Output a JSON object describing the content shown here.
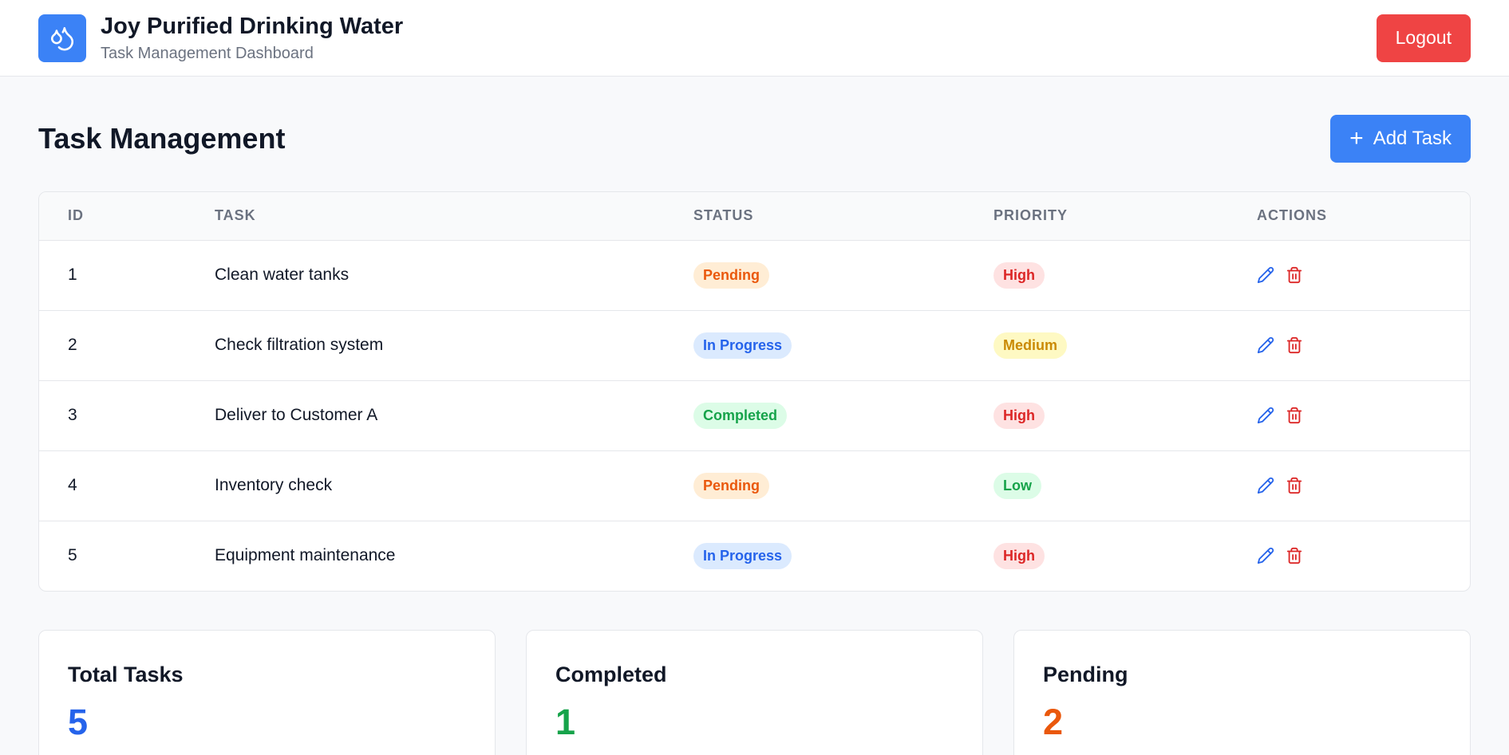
{
  "header": {
    "title": "Joy Purified Drinking Water",
    "subtitle": "Task Management Dashboard",
    "logout_label": "Logout",
    "logo_icon": "water-drops-icon",
    "logo_color": "#3b82f6",
    "logout_color": "#ef4444"
  },
  "main": {
    "title": "Task Management",
    "add_task_label": "Add Task"
  },
  "table": {
    "columns": [
      "ID",
      "TASK",
      "STATUS",
      "PRIORITY",
      "ACTIONS"
    ],
    "rows": [
      {
        "id": "1",
        "task": "Clean water tanks",
        "status": "Pending",
        "priority": "High"
      },
      {
        "id": "2",
        "task": "Check filtration system",
        "status": "In Progress",
        "priority": "Medium"
      },
      {
        "id": "3",
        "task": "Deliver to Customer A",
        "status": "Completed",
        "priority": "High"
      },
      {
        "id": "4",
        "task": "Inventory check",
        "status": "Pending",
        "priority": "Low"
      },
      {
        "id": "5",
        "task": "Equipment maintenance",
        "status": "In Progress",
        "priority": "High"
      }
    ],
    "action_icons": [
      "pencil-icon",
      "trash-icon"
    ]
  },
  "badge_colors": {
    "Pending": {
      "bg": "#ffedd5",
      "fg": "#ea580c"
    },
    "In Progress": {
      "bg": "#dbeafe",
      "fg": "#2563eb"
    },
    "Completed": {
      "bg": "#dcfce7",
      "fg": "#16a34a"
    },
    "High": {
      "bg": "#fee2e2",
      "fg": "#dc2626"
    },
    "Medium": {
      "bg": "#fef9c3",
      "fg": "#ca8a04"
    },
    "Low": {
      "bg": "#dcfce7",
      "fg": "#16a34a"
    }
  },
  "stats": [
    {
      "label": "Total Tasks",
      "value": "5",
      "color": "#2563eb"
    },
    {
      "label": "Completed",
      "value": "1",
      "color": "#16a34a"
    },
    {
      "label": "Pending",
      "value": "2",
      "color": "#ea580c"
    }
  ]
}
